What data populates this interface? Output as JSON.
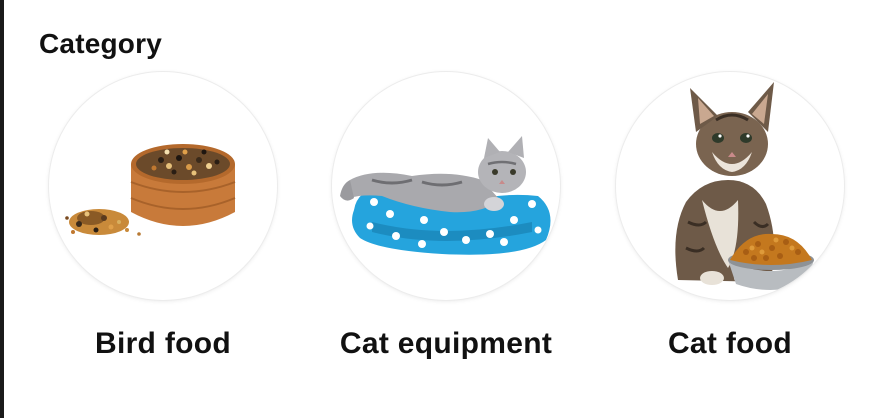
{
  "section": {
    "title": "Category"
  },
  "categories": [
    {
      "label": "Bird food",
      "image": "bird-food-bowl-image"
    },
    {
      "label": "Cat equipment",
      "image": "cat-bed-image"
    },
    {
      "label": "Cat food",
      "image": "kitten-with-food-image"
    }
  ]
}
